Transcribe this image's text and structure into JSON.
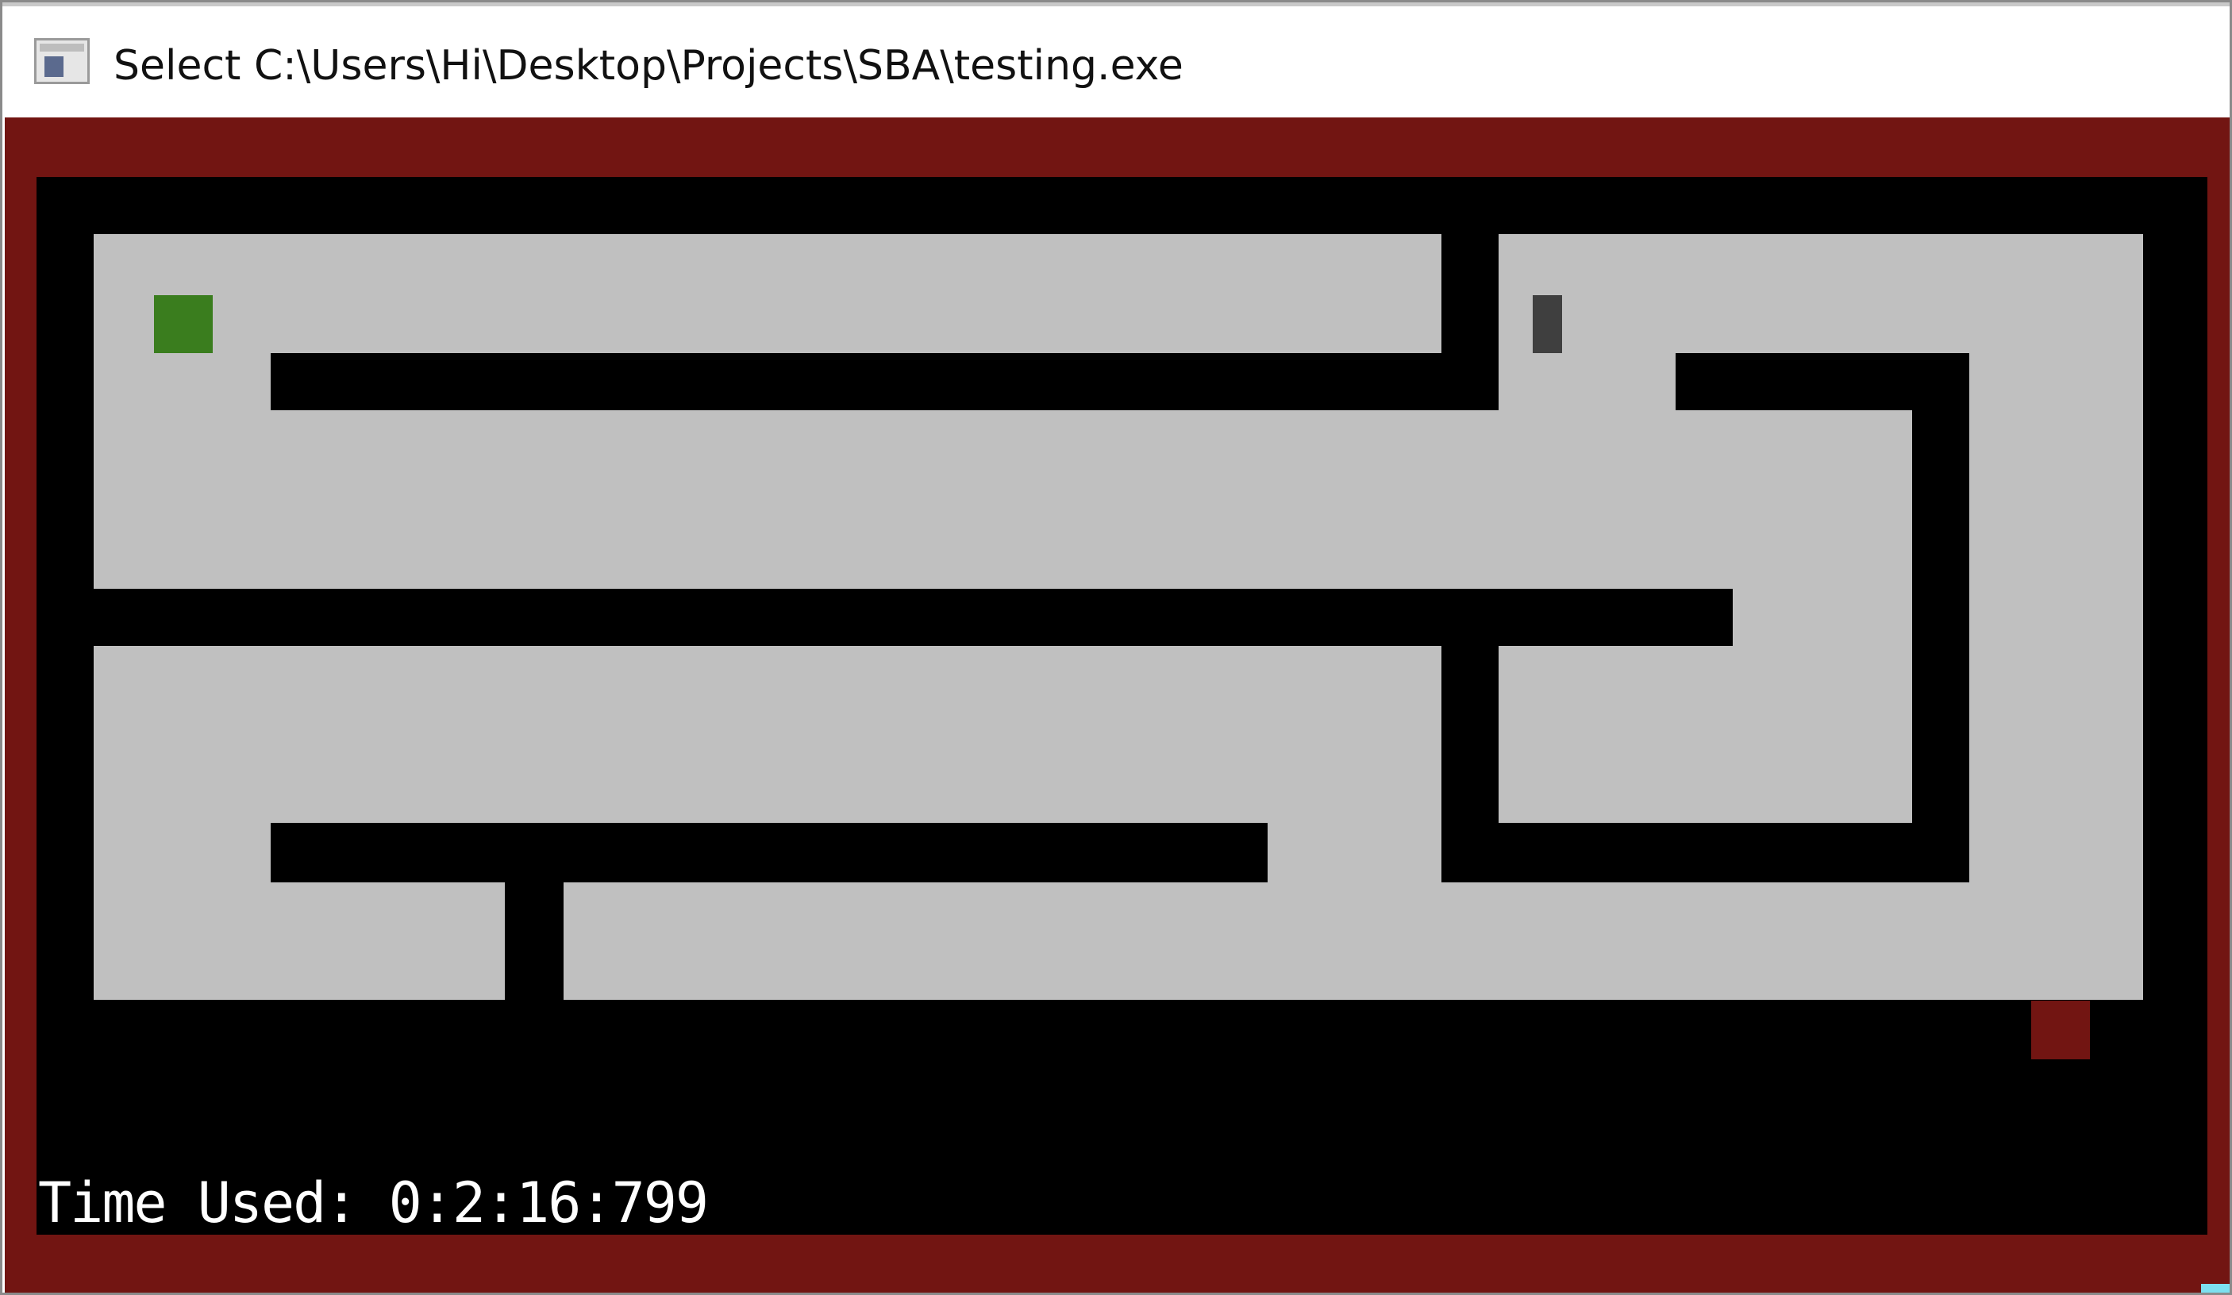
{
  "window": {
    "title": "Select C:\\Users\\Hi\\Desktop\\Projects\\SBA\\testing.exe",
    "icon": "console-app-icon"
  },
  "console": {
    "status_text": "Time Used: 0:2:16:799"
  },
  "game": {
    "colors": {
      "border": "#721512",
      "background": "#000000",
      "floor": "#c0c0c0",
      "player": "#3a7d1e",
      "goal": "#721512",
      "item": "#3f3f3f"
    }
  }
}
